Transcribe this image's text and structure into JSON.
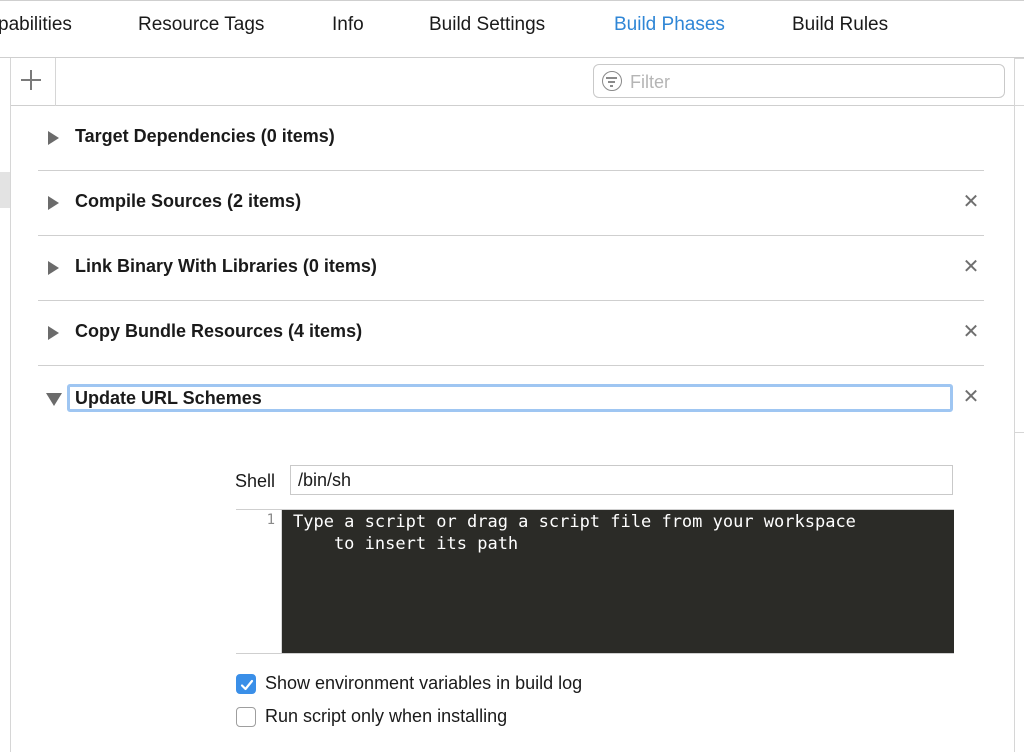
{
  "tabs": [
    {
      "label": "pabilities",
      "active": false
    },
    {
      "label": "Resource Tags",
      "active": false
    },
    {
      "label": "Info",
      "active": false
    },
    {
      "label": "Build Settings",
      "active": false
    },
    {
      "label": "Build Phases",
      "active": true
    },
    {
      "label": "Build Rules",
      "active": false
    }
  ],
  "toolbar": {
    "add_icon": "plus-icon",
    "filter_placeholder": "Filter",
    "filter_icon": "filter-icon"
  },
  "phases": [
    {
      "title": "Target Dependencies (0 items)",
      "expanded": false,
      "removable": false
    },
    {
      "title": "Compile Sources (2 items)",
      "expanded": false,
      "removable": true
    },
    {
      "title": "Link Binary With Libraries (0 items)",
      "expanded": false,
      "removable": true
    },
    {
      "title": "Copy Bundle Resources (4 items)",
      "expanded": false,
      "removable": true
    },
    {
      "title": "Update URL Schemes",
      "expanded": true,
      "removable": true,
      "editing": true
    }
  ],
  "run_script": {
    "shell_label": "Shell",
    "shell_value": "/bin/sh",
    "line_number": "1",
    "script_placeholder": "Type a script or drag a script file from your workspace\n    to insert its path",
    "show_env_label": "Show environment variables in build log",
    "show_env_checked": true,
    "run_only_installing_label": "Run script only when installing",
    "run_only_installing_checked": false
  },
  "colors": {
    "accent": "#2f86d6",
    "checkbox_on": "#3a8fe8",
    "editor_bg": "#2b2b27",
    "focus_ring": "#9fc6f2"
  },
  "close_glyph": "✕"
}
